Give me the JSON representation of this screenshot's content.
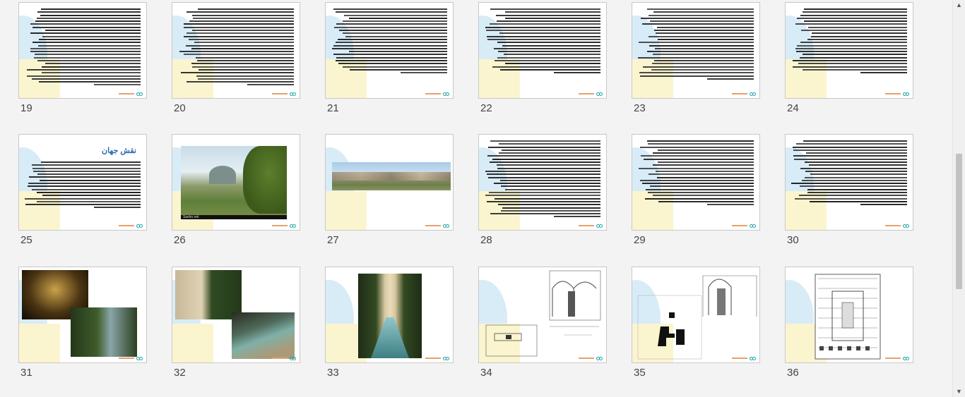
{
  "slides": [
    {
      "num": "19",
      "kind": "text",
      "lines": 26
    },
    {
      "num": "20",
      "kind": "text",
      "lines": 26
    },
    {
      "num": "21",
      "kind": "text",
      "lines": 22
    },
    {
      "num": "22",
      "kind": "text",
      "lines": 22
    },
    {
      "num": "23",
      "kind": "text",
      "lines": 24
    },
    {
      "num": "24",
      "kind": "text",
      "lines": 22
    },
    {
      "num": "25",
      "kind": "title-text",
      "title": "نقش جهان",
      "lines": 16
    },
    {
      "num": "26",
      "kind": "photo-garden",
      "caption": "Sasho.net"
    },
    {
      "num": "27",
      "kind": "photo-panorama"
    },
    {
      "num": "28",
      "kind": "text",
      "lines": 26
    },
    {
      "num": "29",
      "kind": "text",
      "lines": 22
    },
    {
      "num": "30",
      "kind": "text",
      "lines": 22
    },
    {
      "num": "31",
      "kind": "photo-night"
    },
    {
      "num": "32",
      "kind": "photo-pool"
    },
    {
      "num": "33",
      "kind": "photo-fountain"
    },
    {
      "num": "34",
      "kind": "drawing"
    },
    {
      "num": "35",
      "kind": "drawing"
    },
    {
      "num": "36",
      "kind": "plan"
    }
  ],
  "colors": {
    "title": "#2a6bb1",
    "accent": "#1aa3a6",
    "footer": "#e8a06a"
  },
  "scrollbar": {
    "up_icon": "▲",
    "down_icon": "▼"
  }
}
